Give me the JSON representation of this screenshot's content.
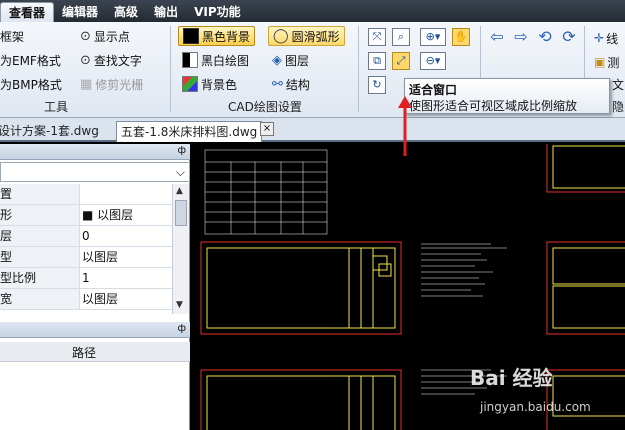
{
  "menu": {
    "items": [
      {
        "label": "查看器"
      },
      {
        "label": "编辑器"
      },
      {
        "label": "高级"
      },
      {
        "label": "输出"
      },
      {
        "label": "VIP功能"
      }
    ]
  },
  "ribbon": {
    "tools": {
      "frame": "框架",
      "emf": "为EMF格式",
      "bmp": "为BMP格式",
      "show_points": "显示点",
      "find_text": "查找文字",
      "trim_raster": "修剪光栅",
      "group_label": "工具"
    },
    "cad_settings": {
      "black_bg": "黑色背景",
      "smooth_arc": "圆滑弧形",
      "bw_drawing": "黑白绘图",
      "layers": "图层",
      "bg_color": "背景色",
      "structure": "结构",
      "group_label": "CAD绘图设置"
    },
    "right_partial": {
      "line": "线",
      "measure": "测",
      "text": "文",
      "hide": "隐"
    }
  },
  "tooltip": {
    "title": "适合窗口",
    "description": "使图形适合可视区域成比例缩放"
  },
  "tabs": [
    {
      "label": "设计方案-1套.dwg",
      "active": false
    },
    {
      "label": "五套-1.8米床排料图.dwg",
      "active": true
    }
  ],
  "tab_close": "×",
  "properties": {
    "pin": "ф",
    "rows": [
      {
        "key": "置",
        "value": ""
      },
      {
        "key": "形",
        "value": "■ 以图层"
      },
      {
        "key": "层",
        "value": "0"
      },
      {
        "key": "型",
        "value": "以图层"
      },
      {
        "key": "型比例",
        "value": "1"
      },
      {
        "key": "宽",
        "value": "以图层"
      }
    ]
  },
  "structure_panel": {
    "column": "路径"
  },
  "watermark": {
    "main": "Bai 经验",
    "sub": "jingyan.baidu.com"
  },
  "colors": {
    "menubar": "#2f363f",
    "canvas": "#000000",
    "cad_red": "#e03030",
    "cad_yellow": "#f2e24a",
    "cad_white": "#ffffff"
  }
}
